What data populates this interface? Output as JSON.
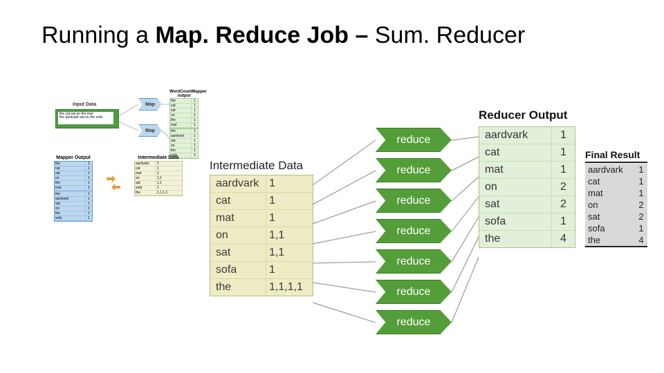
{
  "title_prefix": "Running a ",
  "title_bold": "Map. Reduce Job – ",
  "title_suffix": "Sum. Reducer",
  "thumbs": {
    "input_label": "Input Data",
    "input_text1": "the cat sat on the mat",
    "input_text2": "the aardvark sat on the sofa",
    "map_label": "Map",
    "wc_header": "WordCountMapper output",
    "wc_rows_top": [
      [
        "the",
        "1"
      ],
      [
        "cat",
        "1"
      ],
      [
        "sat",
        "1"
      ],
      [
        "on",
        "1"
      ],
      [
        "the",
        "1"
      ],
      [
        "mat",
        "1"
      ]
    ],
    "wc_rows_bot": [
      [
        "the",
        "1"
      ],
      [
        "aardvark",
        "1"
      ],
      [
        "sat",
        "1"
      ],
      [
        "on",
        "1"
      ],
      [
        "the",
        "1"
      ],
      [
        "sofa",
        "1"
      ]
    ],
    "mo_header": "Mapper Output",
    "mo_rows_top": [
      [
        "the",
        "1"
      ],
      [
        "cat",
        "1"
      ],
      [
        "sat",
        "1"
      ],
      [
        "on",
        "1"
      ],
      [
        "the",
        "1"
      ],
      [
        "mat",
        "1"
      ]
    ],
    "mo_rows_bot": [
      [
        "the",
        "1"
      ],
      [
        "aardvark",
        "1"
      ],
      [
        "sat",
        "1"
      ],
      [
        "on",
        "1"
      ],
      [
        "the",
        "1"
      ],
      [
        "sofa",
        "1"
      ]
    ],
    "int_header": "Intermediate Data",
    "int_rows": [
      [
        "aardvark",
        "1"
      ],
      [
        "cat",
        "1"
      ],
      [
        "mat",
        "1"
      ],
      [
        "on",
        "1,1"
      ],
      [
        "sat",
        "1,1"
      ],
      [
        "sofa",
        "1"
      ],
      [
        "the",
        "1,1,1,1"
      ]
    ]
  },
  "intermediate": {
    "header": "Intermediate Data",
    "rows": [
      [
        "aardvark",
        "1"
      ],
      [
        "cat",
        "1"
      ],
      [
        "mat",
        "1"
      ],
      [
        "on",
        "1,1"
      ],
      [
        "sat",
        "1,1"
      ],
      [
        "sofa",
        "1"
      ],
      [
        "the",
        "1,1,1,1"
      ]
    ]
  },
  "reduce_label": "reduce",
  "reducer_out": {
    "header": "Reducer Output",
    "rows": [
      [
        "aardvark",
        "1"
      ],
      [
        "cat",
        "1"
      ],
      [
        "mat",
        "1"
      ],
      [
        "on",
        "2"
      ],
      [
        "sat",
        "2"
      ],
      [
        "sofa",
        "1"
      ],
      [
        "the",
        "4"
      ]
    ]
  },
  "final": {
    "header": "Final Result",
    "rows": [
      [
        "aardvark",
        "1"
      ],
      [
        "cat",
        "1"
      ],
      [
        "mat",
        "1"
      ],
      [
        "on",
        "2"
      ],
      [
        "sat",
        "2"
      ],
      [
        "sofa",
        "1"
      ],
      [
        "the",
        "4"
      ]
    ]
  }
}
